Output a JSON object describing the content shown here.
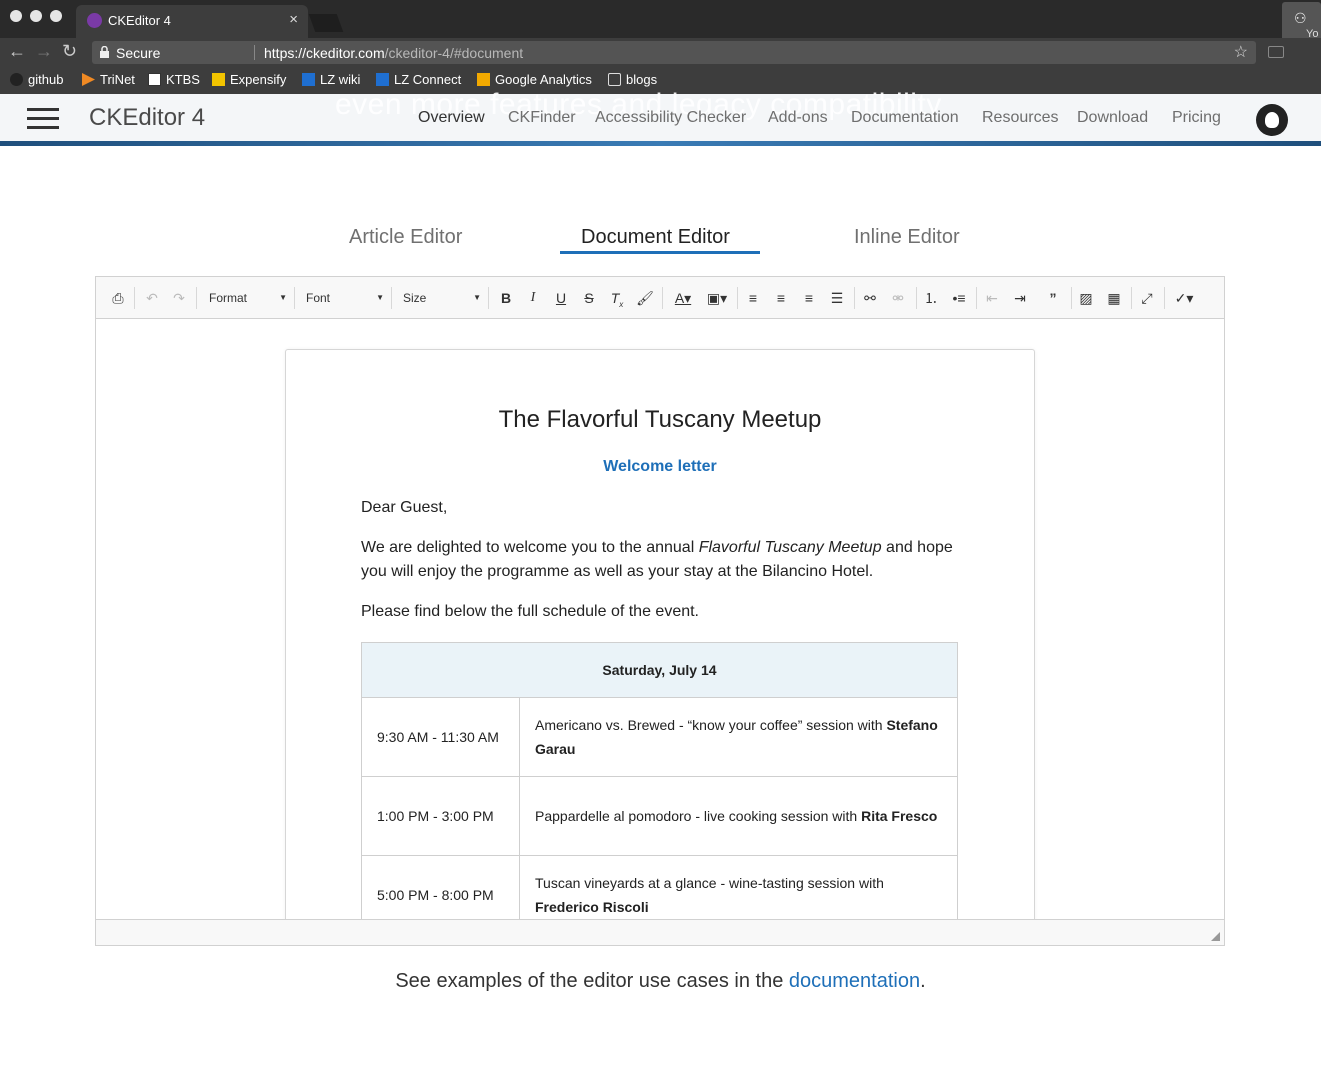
{
  "browser": {
    "tab_title": "CKEditor 4",
    "tab_close": "×",
    "ext_label": "Yo",
    "address": {
      "secure": "Secure",
      "url_host": "https://ckeditor.com",
      "url_path": "/ckeditor-4/#document"
    },
    "bookmarks": [
      {
        "label": "github"
      },
      {
        "label": "TriNet"
      },
      {
        "label": "KTBS"
      },
      {
        "label": "Expensify"
      },
      {
        "label": "LZ wiki"
      },
      {
        "label": "LZ Connect"
      },
      {
        "label": "Google Analytics"
      },
      {
        "label": "blogs"
      }
    ]
  },
  "site": {
    "brand": "CKEditor 4",
    "bg_text": "even more features and legacy compatibility",
    "nav": [
      {
        "label": "Overview"
      },
      {
        "label": "CKFinder"
      },
      {
        "label": "Accessibility Checker"
      },
      {
        "label": "Add-ons"
      },
      {
        "label": "Documentation"
      },
      {
        "label": "Resources"
      },
      {
        "label": "Download"
      },
      {
        "label": "Pricing"
      }
    ]
  },
  "editor_tabs": [
    {
      "label": "Article Editor"
    },
    {
      "label": "Document Editor"
    },
    {
      "label": "Inline Editor"
    }
  ],
  "toolbar": {
    "format": "Format",
    "font": "Font",
    "size": "Size"
  },
  "document": {
    "title": "The Flavorful Tuscany Meetup",
    "subtitle": "Welcome letter",
    "greeting": "Dear Guest,",
    "intro_before": "We are delighted to welcome you to the annual ",
    "intro_italic": "Flavorful Tuscany Meetup",
    "intro_after": " and hope you will enjoy the programme as well as your stay at the Bilancino Hotel.",
    "schedule_intro": "Please find below the full schedule of the event.",
    "schedule": {
      "header": "Saturday, July 14",
      "rows": [
        {
          "time": "9:30 AM - 11:30 AM",
          "text": "Americano vs. Brewed - “know your coffee” session with ",
          "bold": "Stefano Garau"
        },
        {
          "time": "1:00 PM - 3:00 PM",
          "text": "Pappardelle al pomodoro - live cooking session with ",
          "bold": "Rita Fresco"
        },
        {
          "time": "5:00 PM - 8:00 PM",
          "text": "Tuscan vineyards at a glance - wine-tasting session with ",
          "bold": "Frederico Riscoli"
        }
      ]
    }
  },
  "footer": {
    "text": "See examples of the editor use cases in the ",
    "link": "documentation",
    "end": "."
  }
}
